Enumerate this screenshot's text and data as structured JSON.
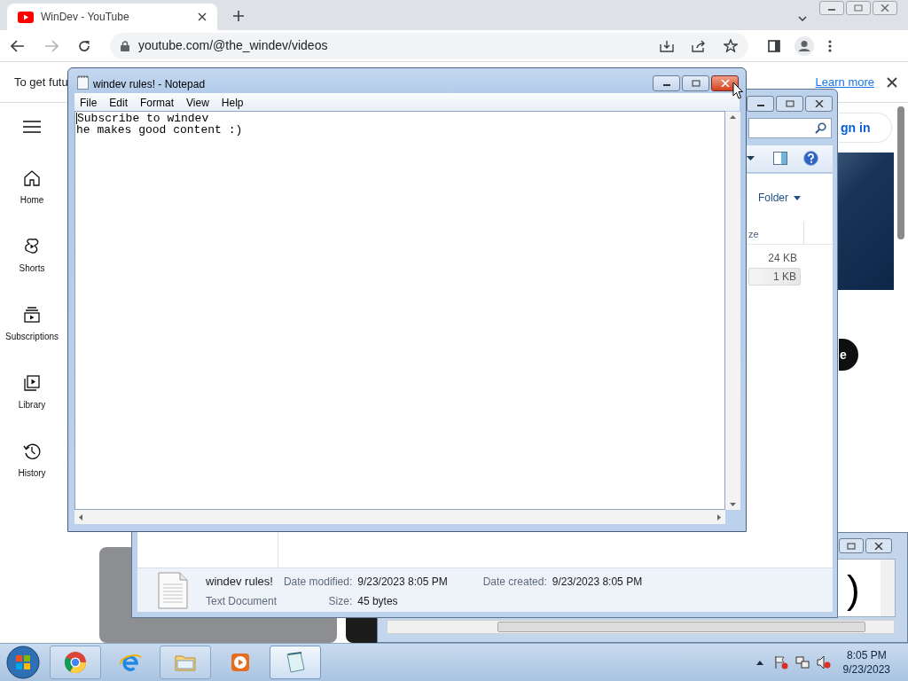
{
  "browser": {
    "tab": {
      "title": "WinDev - YouTube"
    },
    "address": "youtube.com/@the_windev/videos",
    "infobar": {
      "text": "To get futu",
      "link": "Learn more"
    }
  },
  "youtube": {
    "sidebar": [
      {
        "label": "Home",
        "kind": "home"
      },
      {
        "label": "Shorts",
        "kind": "shorts"
      },
      {
        "label": "Subscriptions",
        "kind": "subscriptions"
      },
      {
        "label": "Library",
        "kind": "library"
      },
      {
        "label": "History",
        "kind": "history"
      }
    ],
    "sign_in": "gn in",
    "circle_button": "e"
  },
  "explorer": {
    "view_button": "Folder",
    "column_header": "ze",
    "rows": [
      {
        "size": "24 KB",
        "selected": false
      },
      {
        "size": "1 KB",
        "selected": true
      }
    ],
    "details": {
      "name": "windev rules!",
      "type": "Text Document",
      "fields": [
        {
          "label": "Date modified:",
          "value": "9/23/2023 8:05 PM"
        },
        {
          "label": "Size:",
          "value": "45 bytes"
        },
        {
          "label": "Date created:",
          "value": "9/23/2023 8:05 PM"
        }
      ]
    }
  },
  "back_window": {
    "text": ")"
  },
  "notepad": {
    "title": "windev rules! - Notepad",
    "menu": [
      "File",
      "Edit",
      "Format",
      "View",
      "Help"
    ],
    "lines": [
      "Subscribe to windev",
      "he makes good content :)"
    ]
  },
  "taskbar": {
    "apps": [
      {
        "kind": "chrome",
        "running": true,
        "selected": false
      },
      {
        "kind": "ie",
        "running": false,
        "selected": false
      },
      {
        "kind": "explorer",
        "running": true,
        "selected": false
      },
      {
        "kind": "media",
        "running": false,
        "selected": false
      },
      {
        "kind": "notepad",
        "running": true,
        "selected": true
      }
    ],
    "time": "8:05 PM",
    "date": "9/23/2023"
  }
}
